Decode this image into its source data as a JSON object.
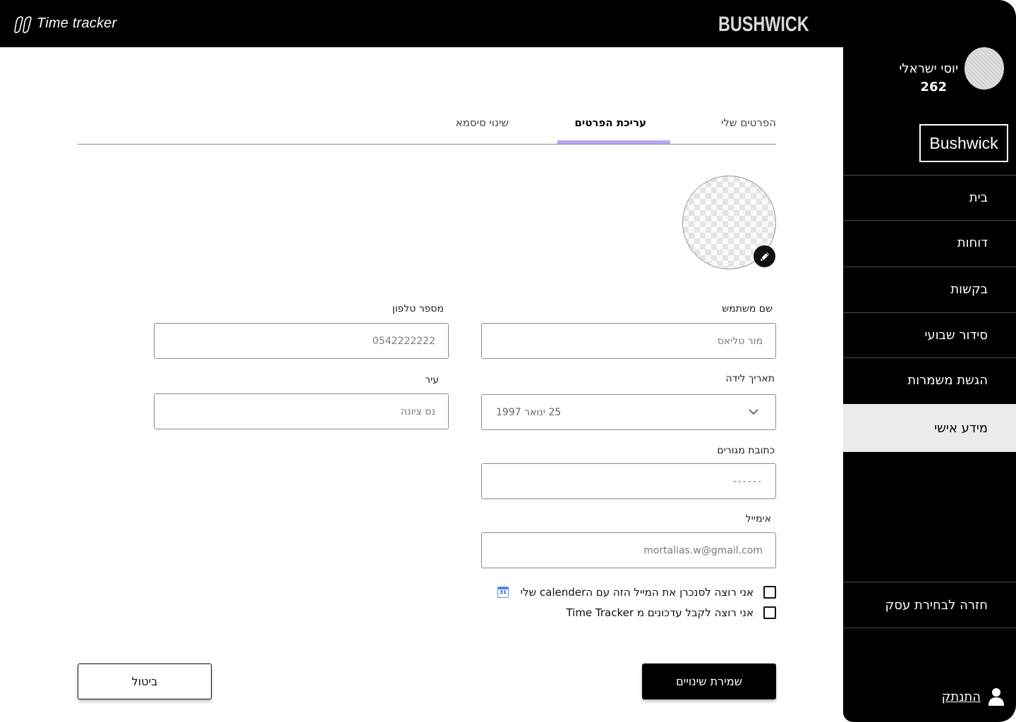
{
  "header": {
    "app_name": "Time tracker",
    "brand": "BUSHWICK"
  },
  "sidebar": {
    "user_name": "יוסי ישראלי",
    "user_id": "262",
    "business": "Bushwick",
    "items": [
      {
        "label": "בית",
        "active": false
      },
      {
        "label": "דוחות",
        "active": false
      },
      {
        "label": "בקשות",
        "active": false
      },
      {
        "label": "סידור שבועי",
        "active": false
      },
      {
        "label": "הגשת משמרות",
        "active": false
      },
      {
        "label": "מידע אישי",
        "active": true
      }
    ],
    "back_label": "חזרה לבחירת עסק",
    "logout_label": "התנתק"
  },
  "tabs": {
    "my_details": "הפרטים שלי",
    "edit_details": "עריכת הפרטים",
    "change_password": "שינוי סיסמא",
    "active": "edit_details"
  },
  "form": {
    "username_label": "שם משתמש",
    "username_placeholder": "מור טליאס",
    "phone_label": "מספר טלפון",
    "phone_placeholder": "0542222222",
    "birthdate_label": "תאריך לידה",
    "birthdate_value": "25 ינואר 1997",
    "city_label": "עיר",
    "city_placeholder": "נס ציונה",
    "address_label": "כתובת מגורים",
    "address_placeholder": "------",
    "email_label": "אימייל",
    "email_placeholder": "mortalias.w@gmail.com",
    "sync_calendar_label": "אני רוצה לסנכרן את המייל הזה עם הcalender שלי",
    "updates_label": "אני רוצה לקבל עדכונים מ Time Tracker",
    "calendar_icon_text": "31"
  },
  "buttons": {
    "save": "שמירת שינויים",
    "cancel": "ביטול"
  },
  "colors": {
    "sidebar_bg": "#000000",
    "active_nav_bg": "#ebebeb",
    "tab_accent": "#b8a6f5"
  }
}
